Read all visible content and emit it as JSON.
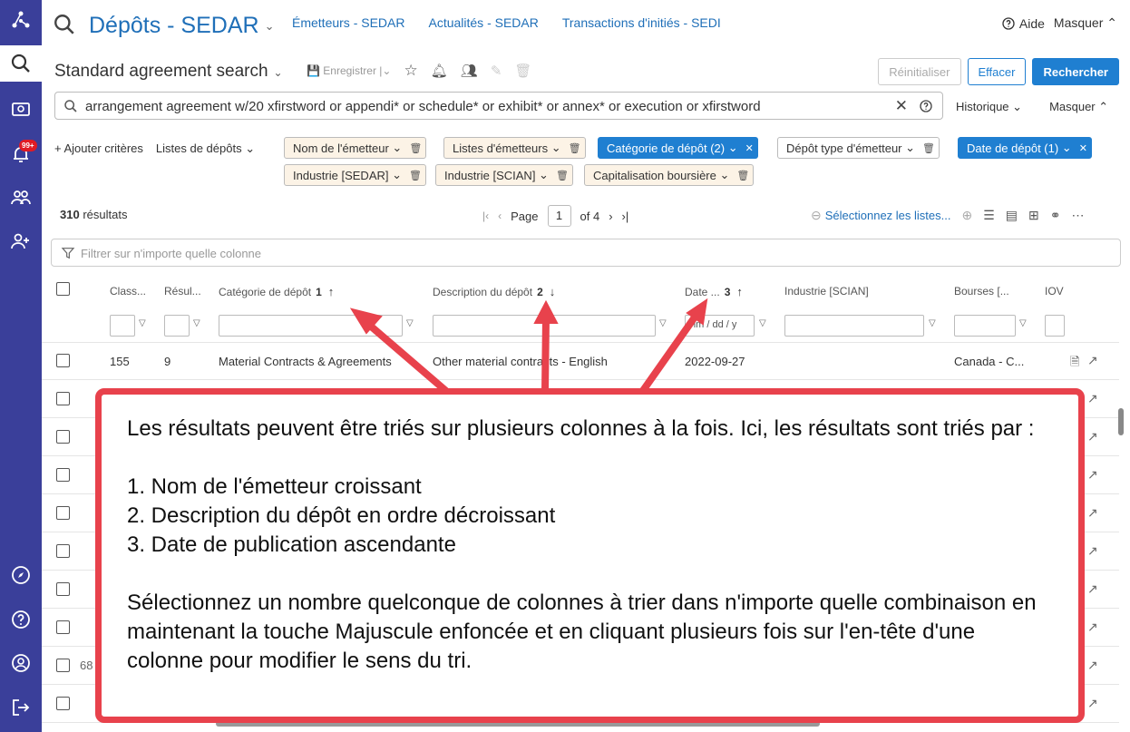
{
  "header": {
    "app_title": "Dépôts - SEDAR",
    "links": [
      "Émetteurs - SEDAR",
      "Actualités - SEDAR",
      "Transactions d'initiés - SEDI"
    ],
    "help": "Aide",
    "hide": "Masquer"
  },
  "notifications_badge": "99+",
  "search": {
    "title": "Standard agreement search",
    "save_label": "Enregistrer",
    "reset": "Réinitialiser",
    "clear": "Effacer",
    "submit": "Rechercher",
    "query": "arrangement agreement w/20 xfirstword or appendi* or schedule* or exhibit* or annex* or execution or xfirstword",
    "history": "Historique",
    "hide": "Masquer"
  },
  "criteria": {
    "add": "+ Ajouter critères",
    "lists": "Listes de dépôts",
    "chips": [
      {
        "label": "Nom de l'émetteur"
      },
      {
        "label": "Listes d'émetteurs"
      },
      {
        "label": "Catégorie de dépôt (2)"
      },
      {
        "label": "Dépôt type d'émetteur"
      },
      {
        "label": "Date de dépôt (1)"
      },
      {
        "label": "Industrie [SEDAR]"
      },
      {
        "label": "Industrie [SCIAN]"
      },
      {
        "label": "Capitalisation boursière"
      }
    ]
  },
  "results": {
    "count": "310",
    "count_label": "résultats",
    "page_label": "Page",
    "page": "1",
    "of": "of 4",
    "select_lists": "Sélectionnez les listes..."
  },
  "filter_placeholder": "Filtrer sur n'importe quelle colonne",
  "table": {
    "columns": [
      {
        "label": "Class..."
      },
      {
        "label": "Résul..."
      },
      {
        "label": "Catégorie de dépôt",
        "sort_order": "1",
        "dir": "↑"
      },
      {
        "label": "Description du dépôt",
        "sort_order": "2",
        "dir": "↓"
      },
      {
        "label": "Date ...",
        "sort_order": "3",
        "dir": "↑"
      },
      {
        "label": "Industrie [SCIAN]"
      },
      {
        "label": "Bourses [..."
      },
      {
        "label": "IOV"
      }
    ],
    "date_placeholder": "mm / dd / y",
    "first_row": [
      "155",
      "9",
      "Material Contracts & Agreements",
      "Other material contracts - English",
      "2022-09-27",
      "Canada - C..."
    ],
    "partial_cell": "68"
  },
  "callout": {
    "text": "Les résultats peuvent être triés sur plusieurs colonnes à la fois. Ici, les résultats sont triés par :\n\n1. Nom de l'émetteur croissant\n2. Description du dépôt en ordre décroissant\n3. Date de publication ascendante\n\nSélectionnez un nombre quelconque de colonnes à trier dans n'importe quelle combinaison en maintenant la touche Majuscule enfoncée et en cliquant plusieurs fois sur l'en-tête d'une colonne pour modifier le sens du tri."
  },
  "colors": {
    "rail": "#3a3f9a",
    "accent": "#1f7fd1",
    "callout": "#e8424c",
    "chip": "#fcf3e6"
  }
}
